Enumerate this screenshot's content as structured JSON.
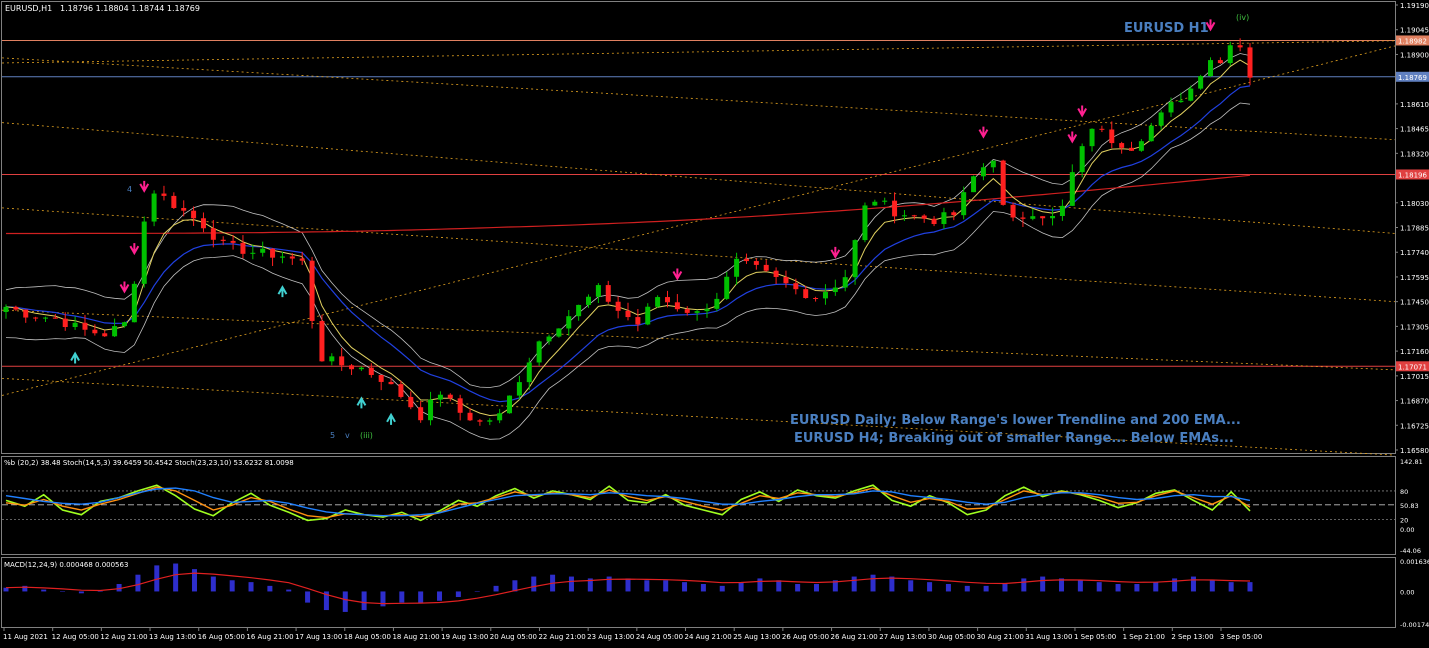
{
  "window": {
    "title": "EURUSD,H1",
    "ohlc": "1.18796 1.18804 1.18744 1.18769"
  },
  "chart_data": [
    {
      "type": "candlestick",
      "panel": "price",
      "symbol": "EURUSD",
      "timeframe": "H1",
      "title_label": "EURUSD H1",
      "annotations": [
        "EURUSD Daily; Below Range's lower Trendline and 200 EMA...",
        "EURUSD H4; Breaking out of smaller Range... Below EMAs..."
      ],
      "wave_labels": [
        "4",
        "5",
        "v",
        "(iii)",
        "(iv)"
      ],
      "ylim": [
        1.1658,
        1.1919
      ],
      "y_ticks": [
        "1.19190",
        "1.19045",
        "1.18900",
        "1.18610",
        "1.18465",
        "1.18320",
        "1.18030",
        "1.17885",
        "1.17740",
        "1.17595",
        "1.17450",
        "1.17305",
        "1.17160",
        "1.17015",
        "1.16870",
        "1.16725",
        "1.16580"
      ],
      "horizontal_levels": [
        {
          "value": "1.18982",
          "color": "#e08060"
        },
        {
          "value": "1.18769",
          "color": "#6080c0"
        },
        {
          "value": "1.18196",
          "color": "#e04040"
        },
        {
          "value": "1.17071",
          "color": "#e04040"
        }
      ],
      "last_price": "1.18769",
      "x_labels": [
        "11 Aug 2021",
        "12 Aug 05:00",
        "12 Aug 21:00",
        "13 Aug 13:00",
        "16 Aug 05:00",
        "16 Aug 21:00",
        "17 Aug 13:00",
        "18 Aug 05:00",
        "18 Aug 21:00",
        "19 Aug 13:00",
        "20 Aug 05:00",
        "22 Aug 21:00",
        "23 Aug 13:00",
        "24 Aug 05:00",
        "24 Aug 21:00",
        "25 Aug 13:00",
        "26 Aug 05:00",
        "26 Aug 21:00",
        "27 Aug 13:00",
        "30 Aug 05:00",
        "30 Aug 21:00",
        "31 Aug 13:00",
        "1 Sep 05:00",
        "1 Sep 21:00",
        "2 Sep 13:00",
        "3 Sep 05:00"
      ],
      "path_points": [
        [
          0,
          1.1742
        ],
        [
          2,
          1.1738
        ],
        [
          5,
          1.1735
        ],
        [
          8,
          1.1728
        ],
        [
          10,
          1.1726
        ],
        [
          12,
          1.1732
        ],
        [
          13,
          1.1758
        ],
        [
          14,
          1.1792
        ],
        [
          15,
          1.181
        ],
        [
          17,
          1.1802
        ],
        [
          20,
          1.179
        ],
        [
          22,
          1.1778
        ],
        [
          25,
          1.1774
        ],
        [
          28,
          1.1772
        ],
        [
          30,
          1.1768
        ],
        [
          31,
          1.1735
        ],
        [
          32,
          1.1712
        ],
        [
          34,
          1.1708
        ],
        [
          36,
          1.1706
        ],
        [
          38,
          1.17
        ],
        [
          40,
          1.169
        ],
        [
          42,
          1.1678
        ],
        [
          44,
          1.1692
        ],
        [
          46,
          1.168
        ],
        [
          48,
          1.1674
        ],
        [
          50,
          1.1678
        ],
        [
          52,
          1.17
        ],
        [
          54,
          1.1722
        ],
        [
          56,
          1.1732
        ],
        [
          58,
          1.1742
        ],
        [
          60,
          1.1752
        ],
        [
          62,
          1.174
        ],
        [
          64,
          1.1732
        ],
        [
          66,
          1.1748
        ],
        [
          68,
          1.1742
        ],
        [
          70,
          1.1738
        ],
        [
          72,
          1.1748
        ],
        [
          74,
          1.1768
        ],
        [
          76,
          1.1764
        ],
        [
          78,
          1.1758
        ],
        [
          80,
          1.1752
        ],
        [
          82,
          1.1748
        ],
        [
          84,
          1.1755
        ],
        [
          85,
          1.176
        ],
        [
          87,
          1.18
        ],
        [
          88,
          1.1805
        ],
        [
          90,
          1.1798
        ],
        [
          92,
          1.1795
        ],
        [
          94,
          1.1793
        ],
        [
          96,
          1.1796
        ],
        [
          98,
          1.1818
        ],
        [
          100,
          1.183
        ],
        [
          101,
          1.18
        ],
        [
          102,
          1.1792
        ],
        [
          104,
          1.1798
        ],
        [
          106,
          1.1794
        ],
        [
          107,
          1.18
        ],
        [
          108,
          1.182
        ],
        [
          110,
          1.1848
        ],
        [
          112,
          1.184
        ],
        [
          114,
          1.1836
        ],
        [
          116,
          1.1848
        ],
        [
          118,
          1.186
        ],
        [
          120,
          1.187
        ],
        [
          121,
          1.188
        ],
        [
          122,
          1.1888
        ],
        [
          123,
          1.1885
        ],
        [
          124,
          1.1898
        ],
        [
          125,
          1.1895
        ],
        [
          126,
          1.1878
        ]
      ],
      "n_bars": 127
    },
    {
      "type": "line",
      "panel": "oscillators",
      "header": "%b (20,2) 38.48  Stoch(14,5,3) 39.6459 50.4542  Stoch(23,23,10) 53.6232 81.0098",
      "y_ticks": [
        "142.81",
        "80",
        "50.83",
        "20",
        "0.00",
        "-44.06"
      ],
      "series": [
        {
          "name": "%b (20,2)",
          "values": [
            60,
            48,
            72,
            40,
            30,
            58,
            66,
            80,
            92,
            70,
            42,
            28,
            55,
            75,
            50,
            35,
            18,
            22,
            40,
            30,
            25,
            35,
            18,
            38,
            60,
            48,
            70,
            85,
            65,
            80,
            72,
            62,
            90,
            60,
            55,
            72,
            50,
            40,
            30,
            62,
            78,
            58,
            82,
            70,
            65,
            80,
            92,
            60,
            48,
            70,
            55,
            30,
            40,
            70,
            88,
            68,
            80,
            72,
            60,
            45,
            55,
            75,
            82,
            60,
            40,
            78,
            38
          ]
        },
        {
          "name": "Stoch(14,5,3)",
          "values": [
            55,
            50,
            62,
            48,
            40,
            52,
            62,
            75,
            88,
            80,
            60,
            40,
            50,
            66,
            58,
            42,
            28,
            24,
            32,
            30,
            28,
            30,
            26,
            34,
            52,
            55,
            66,
            78,
            70,
            76,
            72,
            66,
            82,
            68,
            60,
            68,
            58,
            48,
            40,
            54,
            70,
            64,
            76,
            72,
            68,
            76,
            86,
            70,
            56,
            64,
            58,
            42,
            44,
            62,
            80,
            72,
            78,
            74,
            66,
            54,
            56,
            70,
            80,
            66,
            52,
            70,
            46
          ]
        },
        {
          "name": "Stoch(23,23,10)",
          "values": [
            70,
            64,
            58,
            54,
            52,
            56,
            66,
            76,
            84,
            86,
            80,
            66,
            56,
            58,
            60,
            54,
            44,
            36,
            32,
            30,
            28,
            28,
            30,
            34,
            44,
            54,
            62,
            70,
            72,
            74,
            74,
            72,
            76,
            74,
            70,
            68,
            64,
            58,
            52,
            52,
            58,
            62,
            68,
            72,
            72,
            74,
            80,
            78,
            70,
            66,
            62,
            56,
            52,
            56,
            66,
            72,
            76,
            76,
            72,
            66,
            62,
            64,
            70,
            72,
            68,
            68,
            60
          ]
        }
      ]
    },
    {
      "type": "bar",
      "panel": "macd",
      "header": "MACD(12,24,9) 0.000468 0.000563",
      "y_ticks": [
        "0.001636",
        "0.00",
        "-0.001749"
      ],
      "values": [
        0.0002,
        0.0003,
        0.0001,
        0.0,
        -0.0001,
        0.0,
        0.0004,
        0.0009,
        0.0014,
        0.0015,
        0.0012,
        0.0008,
        0.0006,
        0.0005,
        0.0003,
        0.0001,
        -0.0006,
        -0.001,
        -0.0011,
        -0.001,
        -0.0008,
        -0.0006,
        -0.0006,
        -0.0005,
        -0.0003,
        0.0,
        0.0003,
        0.0006,
        0.0008,
        0.0009,
        0.0008,
        0.0007,
        0.0008,
        0.0007,
        0.0006,
        0.0006,
        0.0005,
        0.0004,
        0.0003,
        0.0005,
        0.0007,
        0.0006,
        0.0004,
        0.0004,
        0.0006,
        0.0008,
        0.0009,
        0.0008,
        0.0006,
        0.0005,
        0.0004,
        0.0003,
        0.0003,
        0.0004,
        0.0007,
        0.0008,
        0.0007,
        0.0006,
        0.0005,
        0.0004,
        0.0004,
        0.0005,
        0.0007,
        0.0008,
        0.0006,
        0.0005,
        0.0005
      ],
      "signal_color": "#e02020",
      "bar_color": "#3a3aff"
    }
  ],
  "colors": {
    "bull": "#00c000",
    "bear": "#ff2020",
    "ema_fast": "#e0d060",
    "ema_mid": "#2040e0",
    "ema_slow": "#d02020",
    "bands": "#c0c0c0",
    "trend": "#e0a020",
    "annotation": "#4a7fc0",
    "arrow_sell": "#ff2090",
    "arrow_buy": "#40d0d0"
  }
}
